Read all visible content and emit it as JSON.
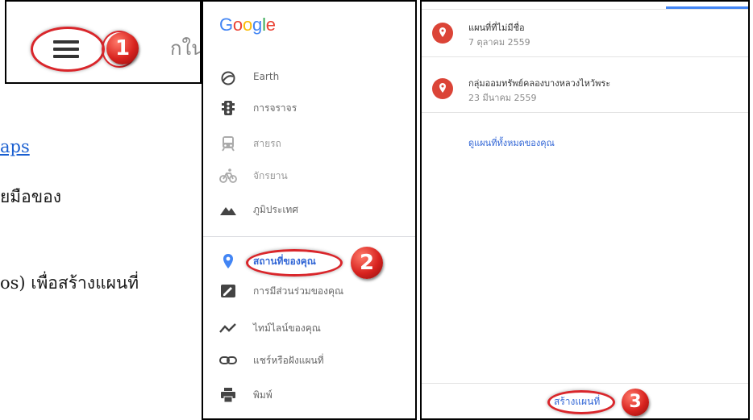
{
  "background_doc": {
    "link_text": "aps",
    "line2": "ยมือของ",
    "line3": "os) เพื่อสร้างแผนที่"
  },
  "step1": {
    "bg_text": "กใน",
    "badge": "1"
  },
  "side_menu": {
    "logo": [
      "G",
      "o",
      "o",
      "g",
      "l",
      "e"
    ],
    "logo_colors": [
      "#4285f4",
      "#ea4335",
      "#fbbc05",
      "#4285f4",
      "#34a853",
      "#ea4335"
    ],
    "items": [
      {
        "label": "Earth",
        "icon": "earth-icon"
      },
      {
        "label": "การจราจร",
        "icon": "traffic-light-icon"
      },
      {
        "label": "สายรถ",
        "icon": "train-icon"
      },
      {
        "label": "จักรยาน",
        "icon": "bicycle-icon"
      },
      {
        "label": "ภูมิประเทศ",
        "icon": "terrain-icon"
      },
      {
        "label": "สถานที่ของคุณ",
        "icon": "place-pin-icon"
      },
      {
        "label": "การมีส่วนร่วมของคุณ",
        "icon": "contribution-icon"
      },
      {
        "label": "ไทม์ไลน์ของคุณ",
        "icon": "timeline-icon"
      },
      {
        "label": "แชร์หรือฝังแผนที่",
        "icon": "link-icon"
      },
      {
        "label": "พิมพ์",
        "icon": "print-icon"
      }
    ],
    "badge": "2"
  },
  "my_maps": {
    "maps": [
      {
        "title": "แผนที่ที่ไม่มีชื่อ",
        "date": "7 ตุลาคม 2559"
      },
      {
        "title": "กลุ่มออมทรัพย์คลองบางหลวงไหว้พระ",
        "date": "23 มีนาคม 2559"
      }
    ],
    "view_all": "ดูแผนที่ทั้งหมดของคุณ",
    "create_map": "สร้างแผนที่",
    "badge": "3"
  },
  "colors": {
    "annotation_red": "#d9262b",
    "link_blue": "#3367d6",
    "pin_red": "#db4437",
    "place_blue": "#4285f4"
  }
}
